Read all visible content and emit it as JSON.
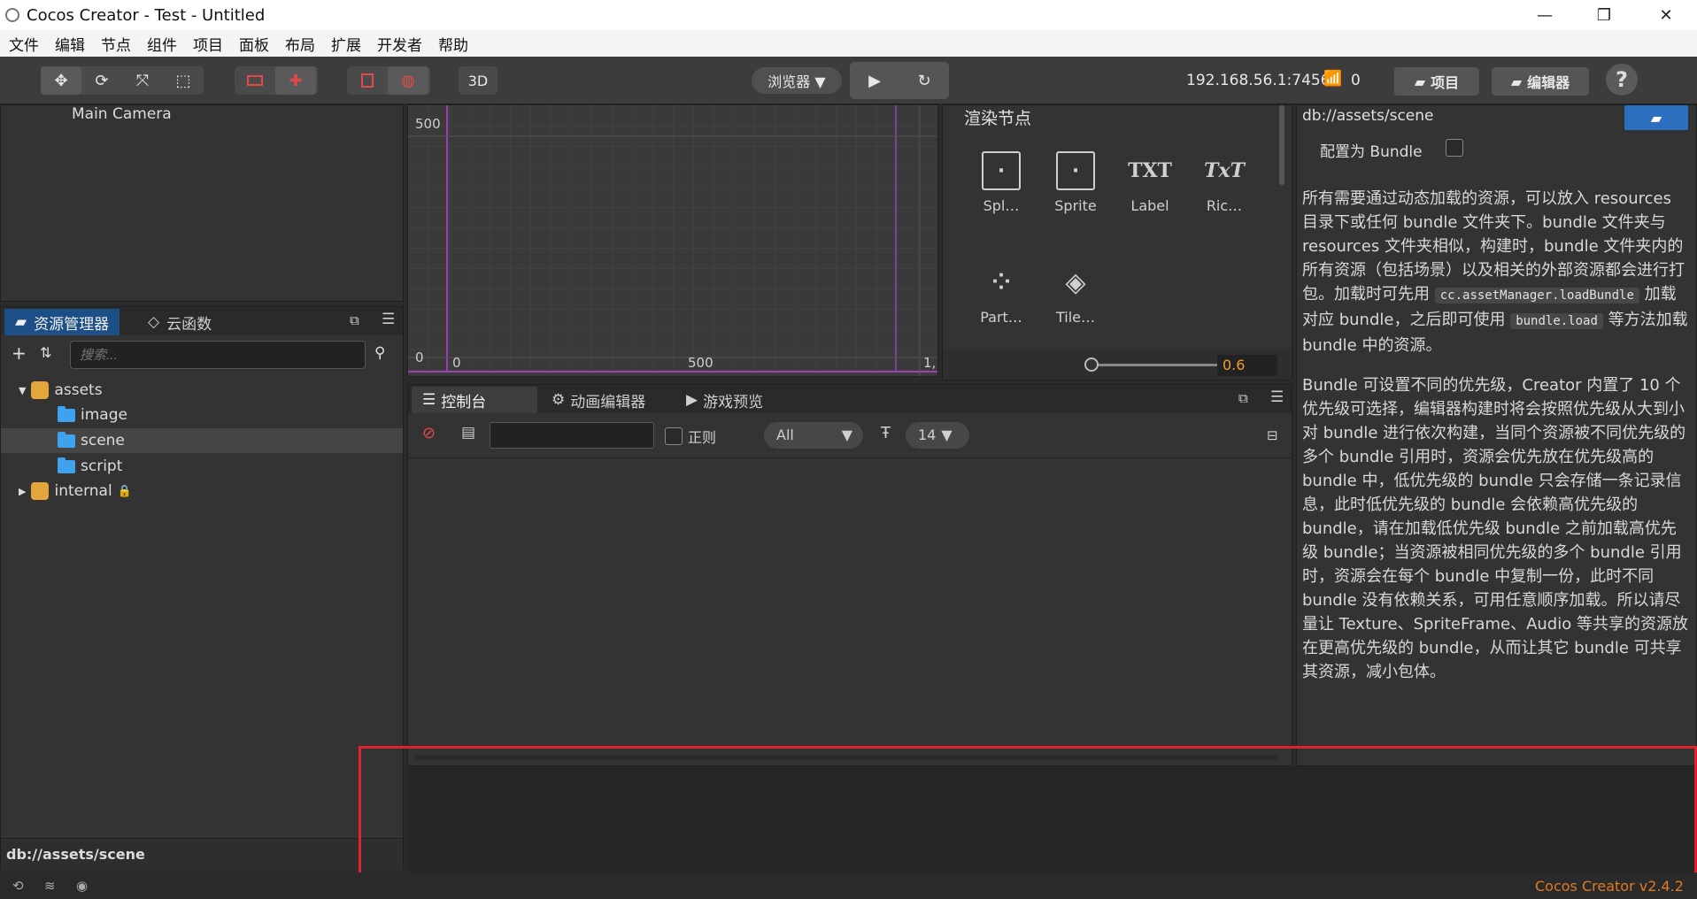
{
  "window": {
    "title": "Cocos Creator - Test - Untitled",
    "minimize": "—",
    "maximize": "❐",
    "close": "✕"
  },
  "menu": [
    "文件",
    "编辑",
    "节点",
    "组件",
    "项目",
    "面板",
    "布局",
    "扩展",
    "开发者",
    "帮助"
  ],
  "toolbar": {
    "mode_3d": "3D",
    "preview_target": "浏览器 ▼",
    "ip": "192.168.56.1:7456",
    "connections": "0",
    "project_btn": "项目",
    "editor_btn": "编辑器",
    "help": "?"
  },
  "hierarchy": {
    "node": "Main Camera"
  },
  "scene": {
    "y_label_top": "500",
    "y_label_bottom": "0",
    "x_label_0": "0",
    "x_label_500": "500",
    "x_label_1": "1,"
  },
  "assets": {
    "tab_active": "资源管理器",
    "tab_other": "云函数",
    "search_placeholder": "搜索...",
    "tree": [
      {
        "label": "assets",
        "type": "cocos",
        "depth": 0,
        "expanded": true
      },
      {
        "label": "image",
        "type": "folder",
        "depth": 1
      },
      {
        "label": "scene",
        "type": "folder",
        "depth": 1,
        "selected": true
      },
      {
        "label": "script",
        "type": "folder",
        "depth": 1
      },
      {
        "label": "internal",
        "type": "cocos",
        "depth": 0,
        "expanded": false,
        "locked": true
      }
    ],
    "footer_path": "db://assets/scene"
  },
  "nodes": {
    "title": "渲染节点",
    "items": [
      "Spl…",
      "Sprite",
      "Label",
      "Ric…",
      "Part…",
      "Tile…"
    ],
    "icon_txt": "TXT",
    "icon_rich": "TxT",
    "zoom_value": "0.6"
  },
  "console": {
    "tabs": [
      "控制台",
      "动画编辑器",
      "游戏预览"
    ],
    "regex_label": "正则",
    "level": "All",
    "font_size": "14"
  },
  "inspector": {
    "path": "db://assets/scene",
    "bundle_label": "配置为 Bundle",
    "para1_a": "所有需要通过动态加载的资源，可以放入 resources 目录下或任何 bundle 文件夹下。bundle 文件夹与 resources 文件夹相似，构建时，bundle 文件夹内的所有资源（包括场景）以及相关的外部资源都会进行打包。加载时可先用 ",
    "para1_code1": "cc.assetManager.loadBundle",
    "para1_b": " 加载对应 bundle，之后即可使用 ",
    "para1_code2": "bundle.load",
    "para1_c": " 等方法加载 bundle 中的资源。",
    "para2": "Bundle 可设置不同的优先级，Creator 内置了 10 个优先级可选择，编辑器构建时将会按照优先级从大到小对 bundle 进行依次构建，当同个资源被不同优先级的多个 bundle 引用时，资源会优先放在优先级高的 bundle 中，低优先级的 bundle 只会存储一条记录信息，此时低优先级的 bundle 会依赖高优先级的 bundle，请在加载低优先级 bundle 之前加载高优先级 bundle；当资源被相同优先级的多个 bundle 引用时，资源会在每个 bundle 中复制一份，此时不同 bundle 没有依赖关系，可用任意顺序加载。所以请尽量让 Texture、SpriteFrame、Audio 等共享的资源放在更高优先级的 bundle，从而让其它 bundle 可共享其资源，减小包体。"
  },
  "status": {
    "version": "Cocos Creator v2.4.2"
  },
  "colors": {
    "accent_red": "#e0222b",
    "version_orange": "#e07a20",
    "zoom_orange": "#f0a030",
    "selection_blue": "#2c6fbf"
  }
}
